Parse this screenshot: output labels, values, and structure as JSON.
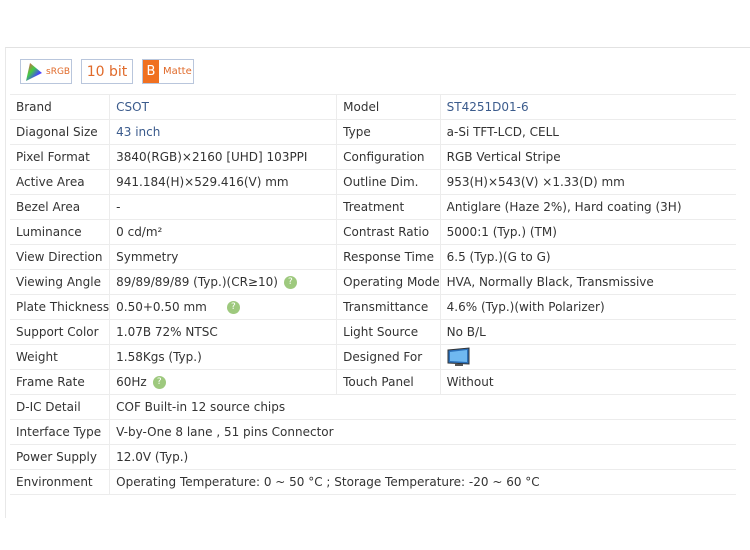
{
  "badges": {
    "srgb": "sRGB",
    "bit": "10 bit",
    "matte_letter": "B",
    "matte": "Matte"
  },
  "rows": [
    {
      "l1": "Brand",
      "v1": "CSOT",
      "l2": "Model",
      "v2": "ST4251D01-6"
    },
    {
      "l1": "Diagonal Size",
      "v1": "43 inch",
      "l2": "Type",
      "v2": "a-Si TFT-LCD, CELL"
    },
    {
      "l1": "Pixel Format",
      "v1": "3840(RGB)×2160  [UHD]  103PPI",
      "l2": "Configuration",
      "v2": "RGB Vertical Stripe"
    },
    {
      "l1": "Active Area",
      "v1": "941.184(H)×529.416(V) mm",
      "l2": "Outline Dim.",
      "v2": "953(H)×543(V) ×1.33(D) mm"
    },
    {
      "l1": "Bezel Area",
      "v1": "-",
      "l2": "Treatment",
      "v2": "Antiglare (Haze 2%), Hard coating (3H)"
    },
    {
      "l1": "Luminance",
      "v1": "0 cd/m²",
      "l2": "Contrast Ratio",
      "v2": "5000:1 (Typ.) (TM)"
    },
    {
      "l1": "View Direction",
      "v1": "Symmetry",
      "l2": "Response Time",
      "v2": "6.5 (Typ.)(G to G)"
    },
    {
      "l1": "Viewing Angle",
      "v1": "89/89/89/89 (Typ.)(CR≥10)",
      "l2": "Operating Mode",
      "v2": "HVA, Normally Black, Transmissive"
    },
    {
      "l1": "Plate Thickness",
      "v1": "0.50+0.50 mm",
      "l2": "Transmittance",
      "v2": "4.6% (Typ.)(with Polarizer)"
    },
    {
      "l1": "Support Color",
      "v1": "1.07B   72% NTSC",
      "l2": "Light Source",
      "v2": "No B/L"
    },
    {
      "l1": "Weight",
      "v1": "1.58Kgs (Typ.)",
      "l2": "Designed For",
      "v2": ""
    },
    {
      "l1": "Frame Rate",
      "v1": "60Hz",
      "l2": "Touch Panel",
      "v2": "Without"
    },
    {
      "l1": "D-IC Detail",
      "v1": "COF Built-in 12 source chips"
    },
    {
      "l1": "Interface Type",
      "v1": "V-by-One 8 lane , 51 pins Connector"
    },
    {
      "l1": "Power Supply",
      "v1": "12.0V (Typ.)"
    },
    {
      "l1": "Environment",
      "v1": "Operating Temperature: 0 ~ 50 °C ; Storage Temperature: -20 ~ 60 °C"
    }
  ],
  "help_glyph": "?"
}
